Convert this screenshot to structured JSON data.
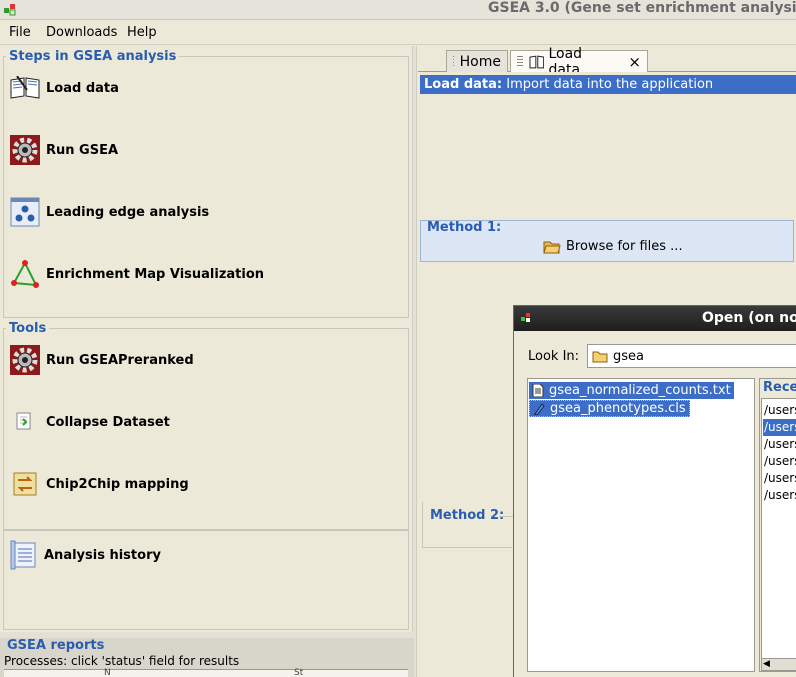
{
  "window": {
    "title": "GSEA 3.0 (Gene set enrichment analysis"
  },
  "menu": [
    "File",
    "Downloads",
    "Help"
  ],
  "steps": {
    "title": "Steps in GSEA analysis",
    "items": [
      {
        "label": "Load data",
        "icon": "book-open-icon"
      },
      {
        "label": "Run GSEA",
        "icon": "gear-icon"
      },
      {
        "label": "Leading edge analysis",
        "icon": "leading-edge-icon"
      },
      {
        "label": "Enrichment Map Visualization",
        "icon": "triangle-network-icon"
      }
    ]
  },
  "tools": {
    "title": "Tools",
    "items": [
      {
        "label": "Run GSEAPreranked",
        "icon": "gear-icon"
      },
      {
        "label": "Collapse Dataset",
        "icon": "collapse-icon"
      },
      {
        "label": "Chip2Chip mapping",
        "icon": "chip-mapping-icon"
      }
    ]
  },
  "history": {
    "label": "Analysis history",
    "icon": "history-list-icon"
  },
  "reports": {
    "title": "GSEA reports",
    "subtitle": "Processes: click 'status' field for results",
    "columns": [
      "N",
      "St"
    ]
  },
  "tabs": [
    {
      "label": "Home",
      "active": false
    },
    {
      "label": "Load data",
      "active": true,
      "close": "×"
    }
  ],
  "load_data": {
    "header_bold": "Load data:",
    "header_text": "Import data into the application",
    "method1_title": "Method 1:",
    "browse_label": "Browse for files ...",
    "method2_title": "Method 2:"
  },
  "dialog": {
    "title": "Open (on no",
    "lookin_label": "Look In:",
    "lookin_value": "gsea",
    "files": [
      {
        "name": "gsea_normalized_counts.txt",
        "icon": "text-file-icon"
      },
      {
        "name": "gsea_phenotypes.cls",
        "icon": "cls-file-icon"
      }
    ],
    "recent_title": "Recen",
    "recent_items": [
      "/users",
      "/users",
      "/users",
      "/users",
      "/users",
      "/users"
    ]
  },
  "colors": {
    "accent": "#3c6ec8",
    "title_blue": "#2a5db0",
    "background": "#ece9d8"
  }
}
